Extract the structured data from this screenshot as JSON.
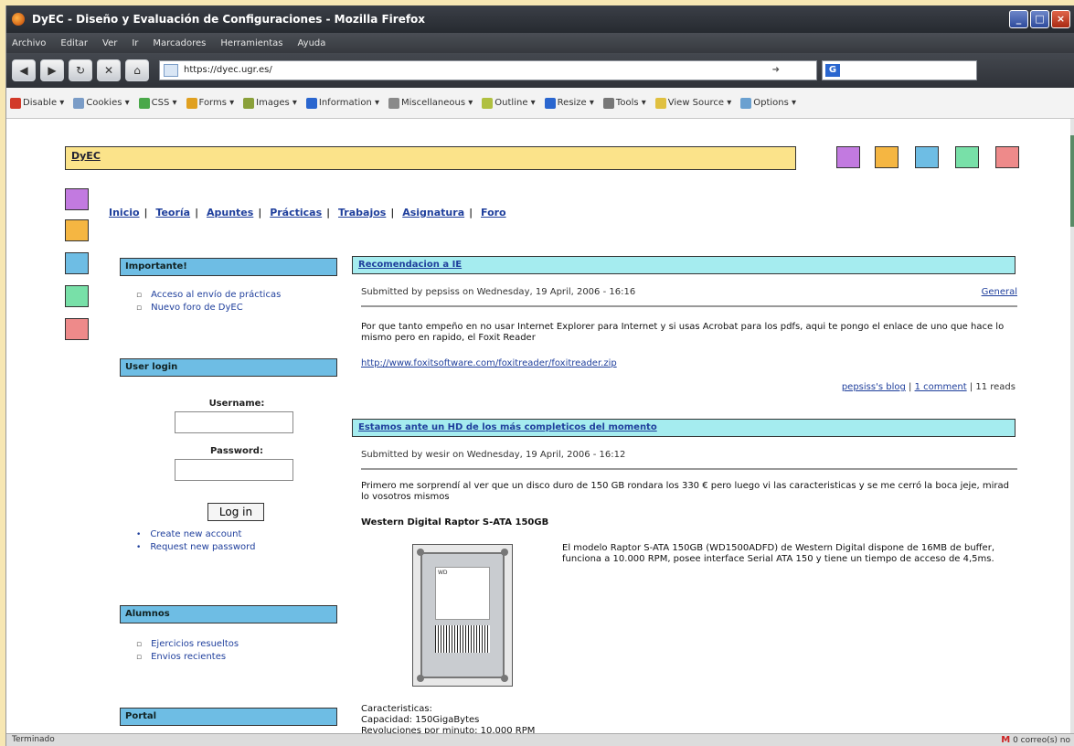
{
  "window": {
    "title": "DyEC - Diseño y Evaluación de Configuraciones - Mozilla Firefox",
    "controls": [
      "_",
      "□",
      "×"
    ]
  },
  "menu": [
    "Archivo",
    "Editar",
    "Ver",
    "Ir",
    "Marcadores",
    "Herramientas",
    "Ayuda"
  ],
  "nav": {
    "url": "https://dyec.ugr.es/",
    "search_engine_letter": "G"
  },
  "devtoolbar": [
    {
      "label": "Disable ▾",
      "icon": "disable-icon",
      "color": "#d23a2a"
    },
    {
      "label": "Cookies ▾",
      "icon": "cookies-icon",
      "color": "#7a9cc7"
    },
    {
      "label": "CSS ▾",
      "icon": "css-icon",
      "color": "#4aa84a"
    },
    {
      "label": "Forms ▾",
      "icon": "forms-icon",
      "color": "#e0a020"
    },
    {
      "label": "Images ▾",
      "icon": "images-icon",
      "color": "#8aa03a"
    },
    {
      "label": "Information ▾",
      "icon": "information-icon",
      "color": "#2a66cf"
    },
    {
      "label": "Miscellaneous ▾",
      "icon": "miscellaneous-icon",
      "color": "#8a8a8a"
    },
    {
      "label": "Outline ▾",
      "icon": "outline-icon",
      "color": "#b0c040"
    },
    {
      "label": "Resize ▾",
      "icon": "resize-icon",
      "color": "#2a66cf"
    },
    {
      "label": "Tools ▾",
      "icon": "tools-icon",
      "color": "#777777"
    },
    {
      "label": "View Source ▾",
      "icon": "view-source-icon",
      "color": "#e0c040"
    },
    {
      "label": "Options ▾",
      "icon": "options-icon",
      "color": "#6aa0d0"
    }
  ],
  "site": {
    "name": "DyEC",
    "color_squares": [
      "#c27ae0",
      "#f5b642",
      "#6ebde4",
      "#78e0a8",
      "#ee8a8a"
    ],
    "tabs": [
      "Inicio",
      "Teoría",
      "Apuntes",
      "Prácticas",
      "Trabajos",
      "Asignatura",
      "Foro"
    ]
  },
  "sidebar": {
    "important": {
      "title": "Importante!",
      "items": [
        "Acceso al envío de prácticas",
        "Nuevo foro de DyEC"
      ]
    },
    "login": {
      "title": "User login",
      "username_label": "Username:",
      "password_label": "Password:",
      "button": "Log in",
      "links": [
        "Create new account",
        "Request new password"
      ]
    },
    "alumnos": {
      "title": "Alumnos",
      "items": [
        "Ejercicios resueltos",
        "Envios recientes"
      ]
    },
    "portal": {
      "title": "Portal"
    }
  },
  "posts": [
    {
      "title": "Recomendacion a IE",
      "meta": "Submitted by pepsiss on Wednesday, 19 April, 2006 - 16:16",
      "category": "General",
      "body": "Por que tanto empeño en no usar Internet Explorer para Internet y si usas Acrobat para los pdfs, aqui te pongo el enlace de uno que hace lo mismo pero en rapido, el Foxit Reader",
      "link": "http://www.foxitsoftware.com/foxitreader/foxitreader.zip",
      "footer": {
        "blog": "pepsiss's blog",
        "comments": "1 comment",
        "reads": "11 reads"
      }
    },
    {
      "title": "Estamos ante un HD de los más completicos del momento",
      "meta": "Submitted by wesir on Wednesday, 19 April, 2006 - 16:12",
      "body": "Primero me sorprendí al ver que un disco duro de 150 GB rondara los 330 € pero luego vi las caracteristicas y se me cerró la boca jeje, mirad lo vosotros mismos",
      "subtitle": "Western Digital Raptor S-ATA 150GB",
      "desc": "El modelo Raptor S-ATA 150GB (WD1500ADFD) de Western Digital dispone de 16MB de buffer, funciona a 10.000 RPM, posee interface Serial ATA 150 y tiene un tiempo de acceso de 4,5ms.",
      "specs_title": "Caracteristicas:",
      "specs": [
        "Capacidad: 150GigaBytes",
        "Revoluciones por minuto: 10.000 RPM"
      ]
    }
  ],
  "status": {
    "text": "Terminado",
    "gmail": "0 correo(s) no"
  }
}
